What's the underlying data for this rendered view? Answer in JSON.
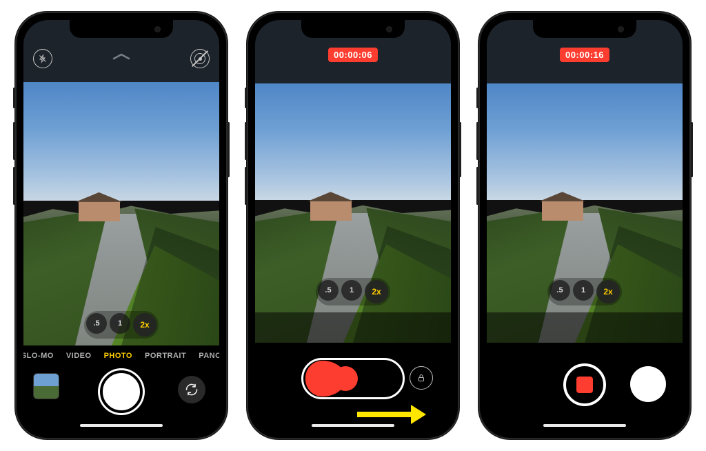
{
  "colors": {
    "accent": "#ffcc00",
    "record": "#fc3d2f",
    "arrow": "#ffe600"
  },
  "zoom": {
    "options": [
      ".5",
      "1",
      "2x"
    ],
    "active_index": 2
  },
  "phone1": {
    "modes": [
      "SLO-MO",
      "VIDEO",
      "PHOTO",
      "PORTRAIT",
      "PANO"
    ],
    "active_mode_index": 2,
    "icons": {
      "flash": "flash-off",
      "live": "live-photo-off",
      "chevron": "chevron-up",
      "flip": "camera-flip"
    }
  },
  "phone2": {
    "timer": "00:00:06",
    "lock_icon": "lock",
    "hint_arrow": "drag-right-arrow"
  },
  "phone3": {
    "timer": "00:00:16",
    "stop_icon": "stop-square",
    "capture_icon": "still-capture"
  }
}
